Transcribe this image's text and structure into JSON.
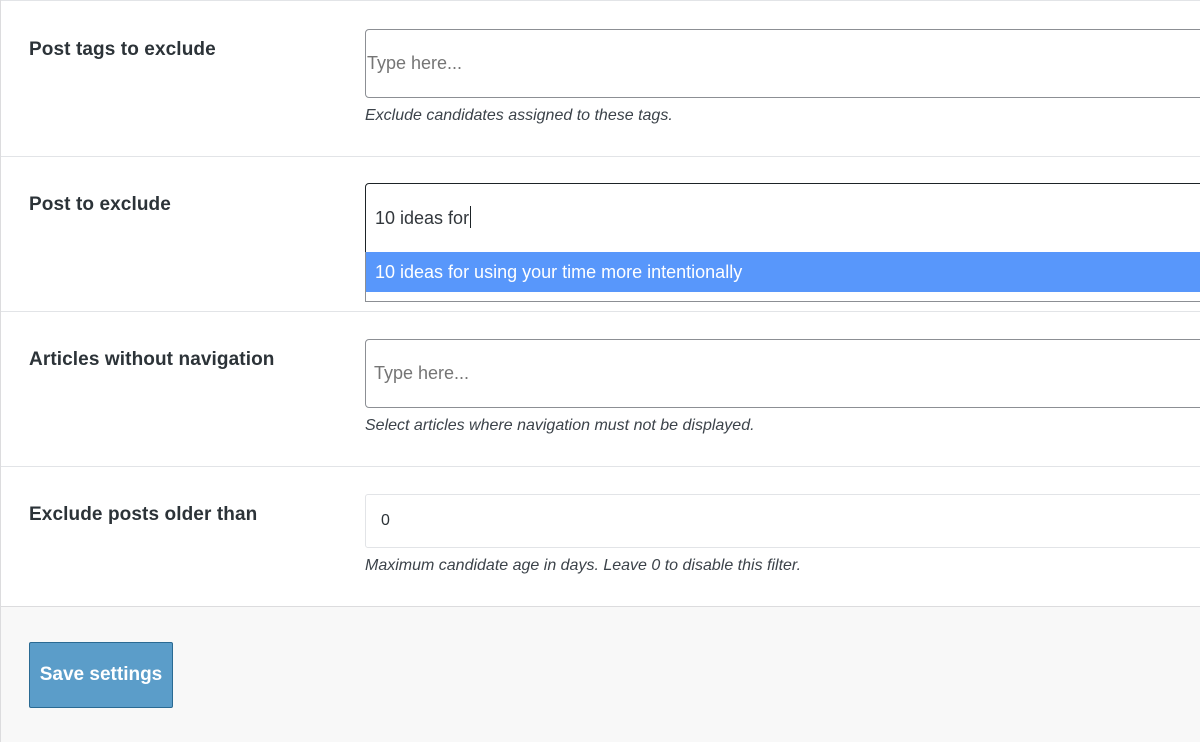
{
  "settings": {
    "post_tags": {
      "label": "Post tags to exclude",
      "placeholder": "Type here...",
      "help": "Exclude candidates assigned to these tags."
    },
    "post_exclude": {
      "label": "Post to exclude",
      "value": "10 ideas for",
      "suggestion": "10 ideas for using your time more intentionally"
    },
    "no_navigation": {
      "label": "Articles without navigation",
      "placeholder": "Type here...",
      "help": "Select articles where navigation must not be displayed."
    },
    "older_than": {
      "label": "Exclude posts older than",
      "value": "0",
      "help": "Maximum candidate age in days. Leave 0 to disable this filter."
    }
  },
  "footer": {
    "save_label": "Save settings"
  },
  "colors": {
    "highlight": "#5897fb",
    "button": "#5b9dc9"
  }
}
